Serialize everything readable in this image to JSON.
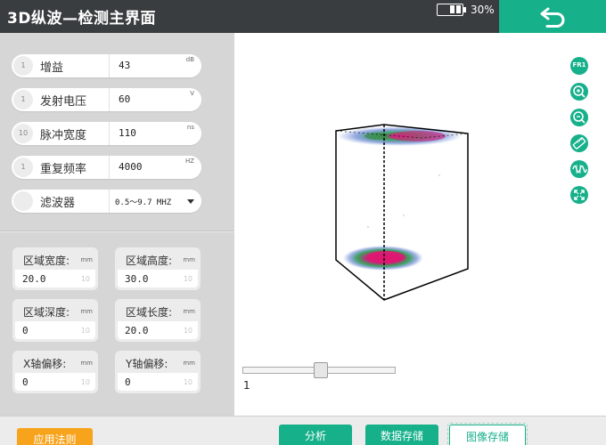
{
  "header": {
    "title": "3D纵波—检测主界面",
    "battery_percent": "30%",
    "battery_level": 0.3,
    "back_icon": "undo-arrow-icon"
  },
  "params": [
    {
      "index": "1",
      "label": "增益",
      "value": "43",
      "unit": "dB"
    },
    {
      "index": "1",
      "label": "发射电压",
      "value": "60",
      "unit": "V"
    },
    {
      "index": "10",
      "label": "脉冲宽度",
      "value": "110",
      "unit": "ns"
    },
    {
      "index": "1",
      "label": "重复频率",
      "value": "4000",
      "unit": "HZ"
    },
    {
      "index": "",
      "label": "滤波器",
      "value": "0.5～9.7 MHZ",
      "unit": ""
    }
  ],
  "region_fields": [
    {
      "label": "区域宽度:",
      "unit": "mm",
      "value": "20.0",
      "hint": "10"
    },
    {
      "label": "区域高度:",
      "unit": "mm",
      "value": "30.0",
      "hint": "10"
    },
    {
      "label": "区域深度:",
      "unit": "mm",
      "value": "0",
      "hint": "10"
    },
    {
      "label": "区域长度:",
      "unit": "mm",
      "value": "20.0",
      "hint": "10"
    },
    {
      "label": "X轴偏移:",
      "unit": "mm",
      "value": "0",
      "hint": "10"
    },
    {
      "label": "Y轴偏移:",
      "unit": "mm",
      "value": "0",
      "hint": "10"
    }
  ],
  "tools": [
    {
      "name": "fr1-icon",
      "text": "FR1"
    },
    {
      "name": "zoom-in-icon",
      "text": ""
    },
    {
      "name": "zoom-out-icon",
      "text": ""
    },
    {
      "name": "ruler-icon",
      "text": ""
    },
    {
      "name": "waveform-icon",
      "text": ""
    },
    {
      "name": "fullscreen-icon",
      "text": ""
    }
  ],
  "slider": {
    "value": "1"
  },
  "buttons": {
    "apply_rule": "应用法则",
    "analyze": "分析",
    "save_data": "数据存储",
    "save_image": "图像存储"
  },
  "colors": {
    "accent": "#16b08a",
    "header": "#3a3d3f",
    "orange": "#f8a31c",
    "panel": "#d6d6d6"
  }
}
